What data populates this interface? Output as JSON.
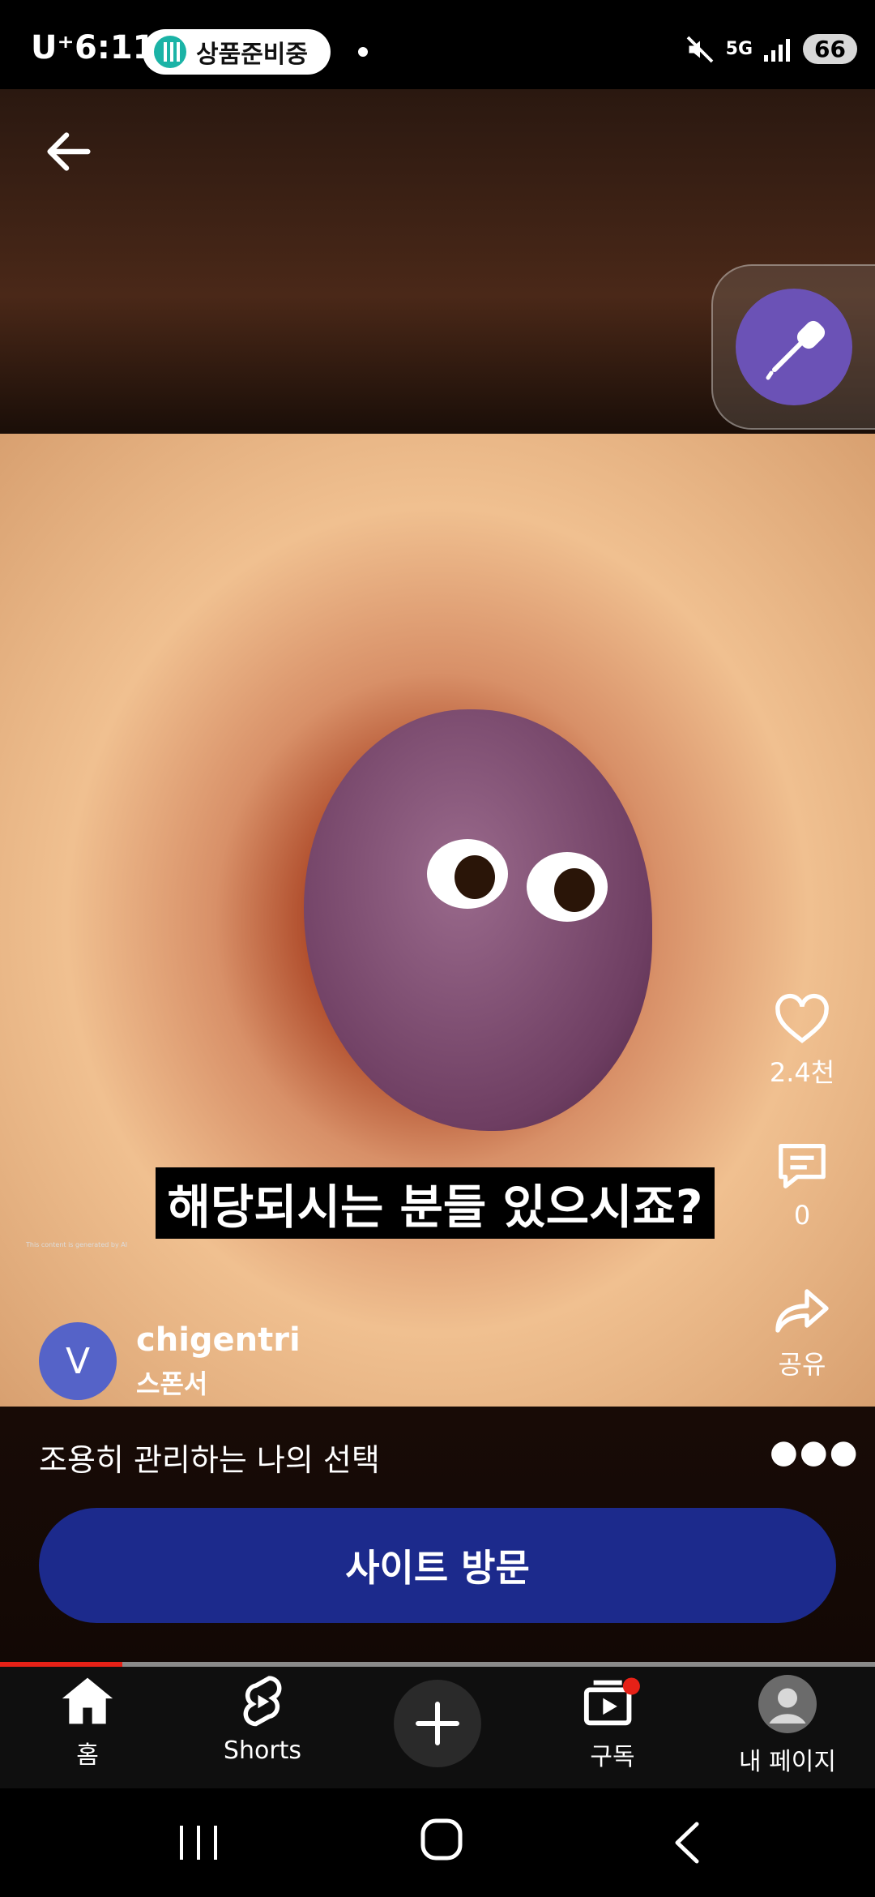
{
  "status_bar": {
    "carrier": "U⁺",
    "time": "6:11",
    "notification": "상품준비중",
    "network": "5G",
    "battery": "66"
  },
  "video": {
    "caption": "해당되시는 분들 있으시죠?",
    "ai_notice": "This content is generated by AI"
  },
  "actions": {
    "like_count": "2.4천",
    "comment_count": "0",
    "share_label": "공유"
  },
  "channel": {
    "avatar_letter": "V",
    "name": "chigentri",
    "sponsor_label": "스폰서"
  },
  "description": "조용히 관리하는 나의 선택",
  "cta_label": "사이트 방문",
  "progress": 0.14,
  "bottom_nav": {
    "home": "홈",
    "shorts": "Shorts",
    "subscriptions": "구독",
    "you": "내 페이지"
  },
  "colors": {
    "cta": "#1c2a8c",
    "progress": "#e62117",
    "fab": "#6b52b6",
    "notification_dot": "#e62117"
  }
}
